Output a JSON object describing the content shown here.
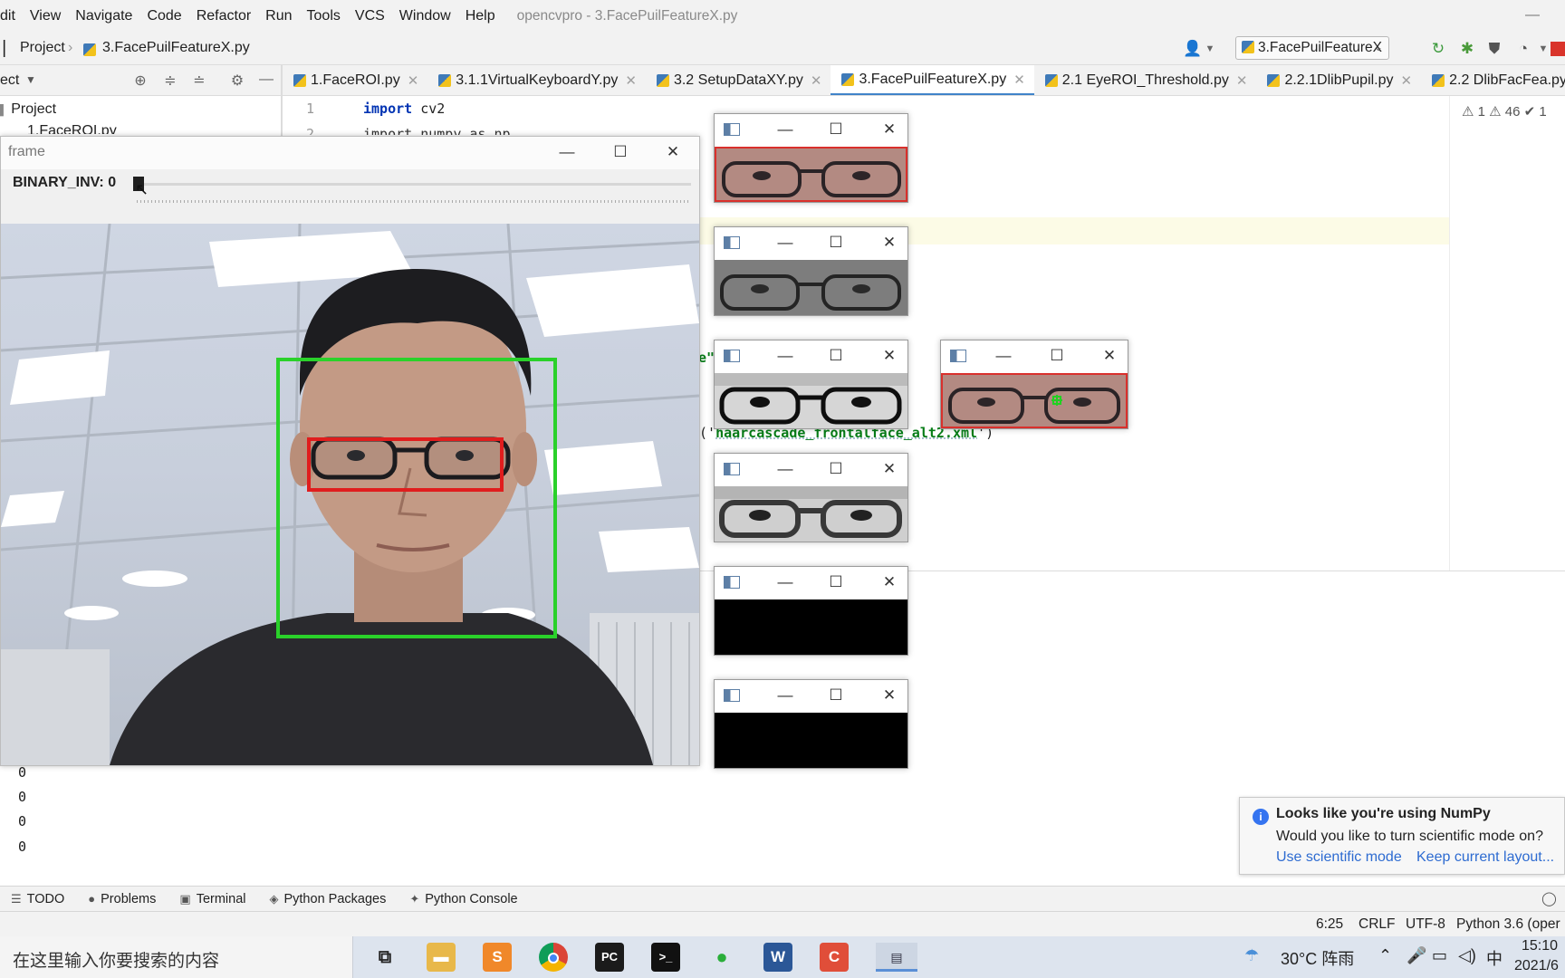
{
  "menu": {
    "items": [
      "dit",
      "View",
      "Navigate",
      "Code",
      "Refactor",
      "Run",
      "Tools",
      "VCS",
      "Window",
      "Help"
    ],
    "title": "opencvpro - 3.FacePuilFeatureX.py"
  },
  "nav": {
    "crumb_project": "Project",
    "crumb_file": "3.FacePuilFeatureX.py",
    "run_config": "3.FacePuilFeatureX"
  },
  "project_panel": {
    "title": "ect",
    "root": "Project",
    "first_file": "1.FaceROI.py"
  },
  "tabs": [
    {
      "label": "1.FaceROI.py",
      "active": false
    },
    {
      "label": "3.1.1VirtualKeyboardY.py",
      "active": false
    },
    {
      "label": "3.2 SetupDataXY.py",
      "active": false
    },
    {
      "label": "3.FacePuilFeatureX.py",
      "active": true
    },
    {
      "label": "2.1 EyeROI_Threshold.py",
      "active": false
    },
    {
      "label": "2.2.1DlibPupil.py",
      "active": false
    },
    {
      "label": "2.2 DlibFacFea.py",
      "active": false
    }
  ],
  "editor": {
    "line1_no": "1",
    "line2_no": "2",
    "line1_kw": "import",
    "line1_rest": " cv2",
    "line2_text": "import numpy as np",
    "frag_e": "e\"",
    "frag_cascade_open": "('",
    "frag_cascade_str": "haarcascade_frontalface_alt2.xml",
    "frag_cascade_close": "')",
    "inspections": "⚠ 1   ⚠ 46  ✔ 1"
  },
  "frame_window": {
    "title": "frame",
    "trackbar_label": "BINARY_INV: 0",
    "trackbar_value": 0
  },
  "console": {
    "lines": [
      "0",
      "0",
      "0",
      "0"
    ]
  },
  "notification": {
    "title": "Looks like you're using NumPy",
    "body": "Would you like to turn scientific mode on?",
    "link_scientific": "Use scientific mode",
    "link_keep": "Keep current layout..."
  },
  "tool_tabs": [
    "TODO",
    "Problems",
    "Terminal",
    "Python Packages",
    "Python Console"
  ],
  "status": {
    "position": "6:25",
    "line_sep": "CRLF",
    "encoding": "UTF-8",
    "interpreter": "Python 3.6 (oper"
  },
  "taskbar": {
    "search_placeholder": "在这里输入你要搜索的内容",
    "weather": "30°C  阵雨",
    "ime": "中",
    "time": "15:10",
    "date": "2021/6"
  },
  "colors": {
    "face_box": "#2ad12a",
    "eye_box": "#e01d1d",
    "accent": "#4083c9",
    "link": "#2d6bd1"
  }
}
